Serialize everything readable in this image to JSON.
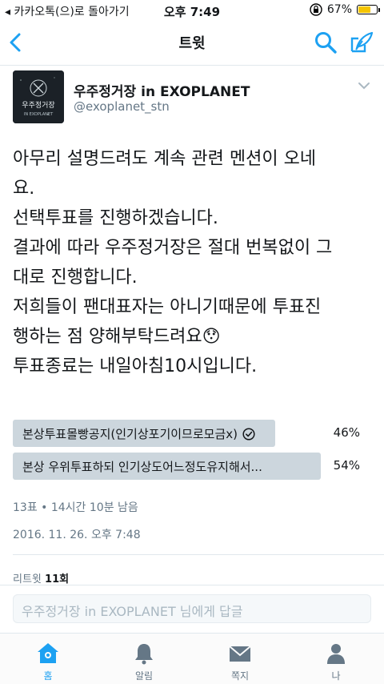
{
  "status_bar": {
    "carrier": "◂ 카카오톡(으)로 돌아가기",
    "time": "오후 7:49",
    "battery": "67%",
    "battery_level": 0.67
  },
  "nav": {
    "title": "트윗"
  },
  "author": {
    "name": "우주정거장 in EXOPLANET",
    "handle": "@exoplanet_stn",
    "avatar_text_1": "우주정거장",
    "avatar_text_2": "IN EXOPLANET"
  },
  "tweet": {
    "lines": [
      "아무리 설명드려도 계속 관련 멘션이 오네",
      "요.",
      "선택투표를 진행하겠습니다.",
      "결과에 따라 우주정거장은 절대 번복없이 그",
      "대로 진행합니다.",
      "저희들이 팬대표자는 아니기때문에 투표진",
      "행하는 점 양해부탁드려요😯",
      "투표종료는 내일아침10시입니다."
    ],
    "poll": {
      "options": [
        {
          "label": "본상투표몰빵공지(인기상포기이므로모금x)",
          "percent": "46%",
          "value": 46,
          "selected": true
        },
        {
          "label": "본상 우위투표하되 인기상도어느정도유지해서...",
          "percent": "54%",
          "value": 54,
          "selected": false
        }
      ],
      "meta": "13표 • 14시간 10분 남음"
    },
    "date": "2016. 11. 26. 오후 7:48",
    "retweets_label": "리트윗",
    "retweets_count": "11회"
  },
  "reply": {
    "placeholder": "우주정거장 in EXOPLANET 님에게 답글"
  },
  "tabs": [
    {
      "label": "홈",
      "icon": "home-icon",
      "active": true
    },
    {
      "label": "알림",
      "icon": "bell-icon",
      "active": false
    },
    {
      "label": "쪽지",
      "icon": "envelope-icon",
      "active": false
    },
    {
      "label": "나",
      "icon": "person-icon",
      "active": false
    }
  ],
  "colors": {
    "accent": "#1da1f2",
    "poll_fill": "#ccd6dd",
    "secondary_text": "#657786",
    "battery": "#f5c400"
  }
}
